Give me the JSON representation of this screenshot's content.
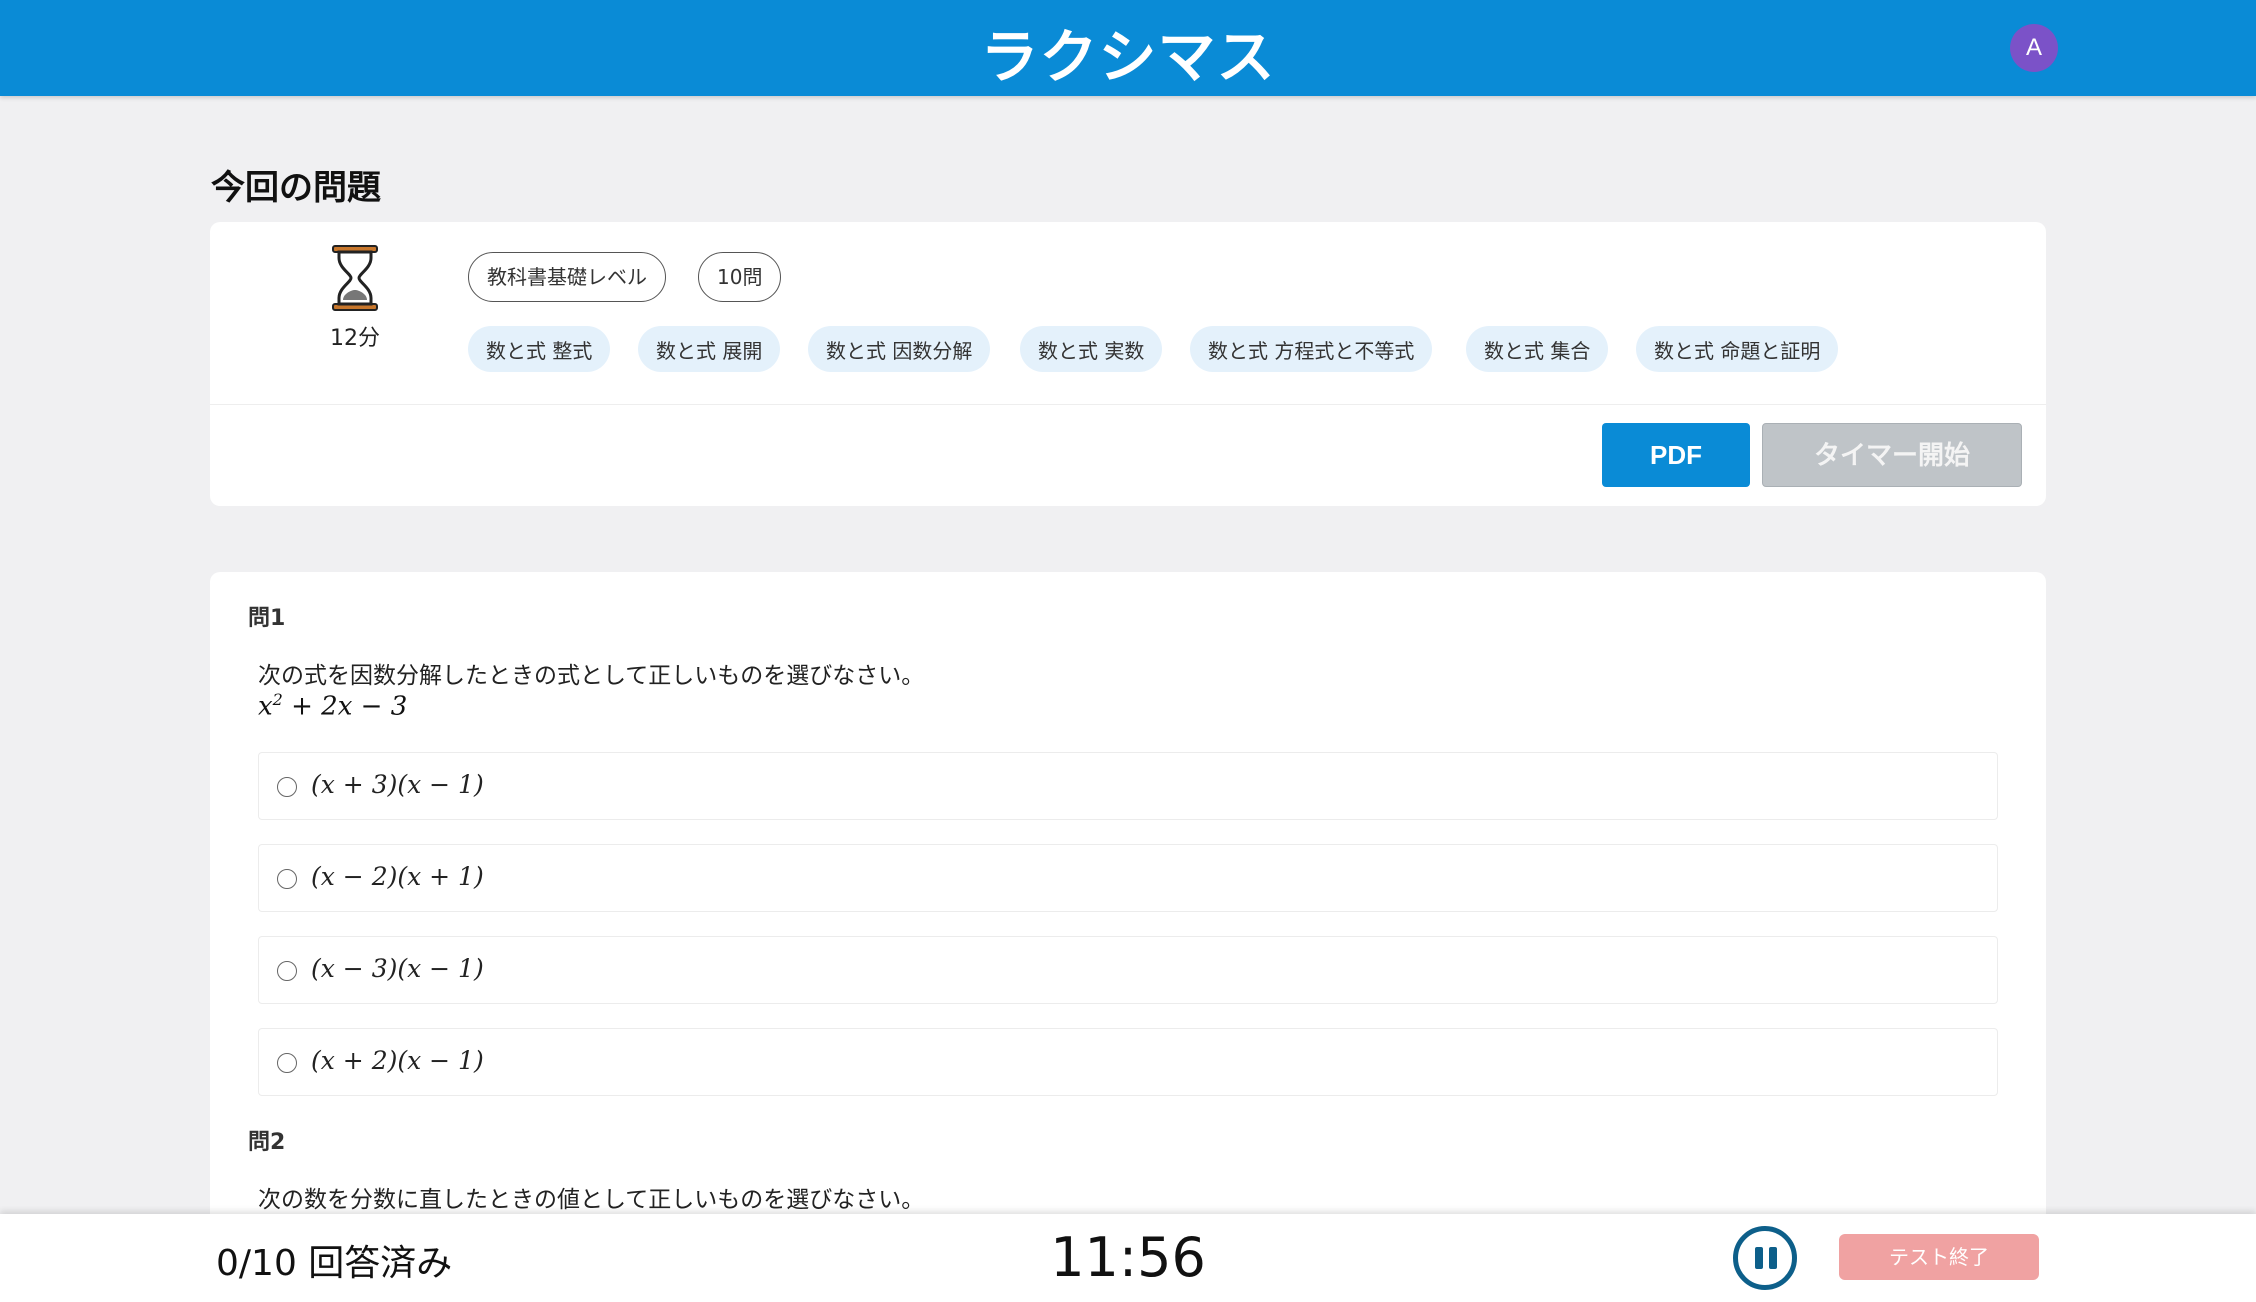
{
  "header": {
    "logo": "ラクシマス",
    "avatar_initial": "A"
  },
  "section_title": "今回の問題",
  "summary": {
    "time": "12分",
    "level_tag": "教科書基礎レベル",
    "count_tag": "10問",
    "topics": [
      "数と式 整式",
      "数と式 展開",
      "数と式 因数分解",
      "数と式 実数",
      "数と式 方程式と不等式",
      "数と式 集合",
      "数と式 命題と証明"
    ],
    "pdf_button": "PDF",
    "timer_button": "タイマー開始"
  },
  "questions": [
    {
      "label": "問1",
      "text": "次の式を因数分解したときの式として正しいものを選びなさい。",
      "formula_base": "x",
      "formula_exp": "2",
      "formula_rest": " + 2x − 3",
      "choices": [
        "(x + 3)(x − 1)",
        "(x − 2)(x + 1)",
        "(x − 3)(x − 1)",
        "(x + 2)(x − 1)"
      ]
    },
    {
      "label": "問2",
      "text": "次の数を分数に直したときの値として正しいものを選びなさい。"
    }
  ],
  "footer": {
    "answered": "0/10 回答済み",
    "clock": "11:56",
    "end_button": "テスト終了"
  },
  "colors": {
    "brand": "#0a8bd6",
    "avatar": "#7b52c8",
    "end_button": "#f0a2a2",
    "pause": "#0d5f8a"
  }
}
